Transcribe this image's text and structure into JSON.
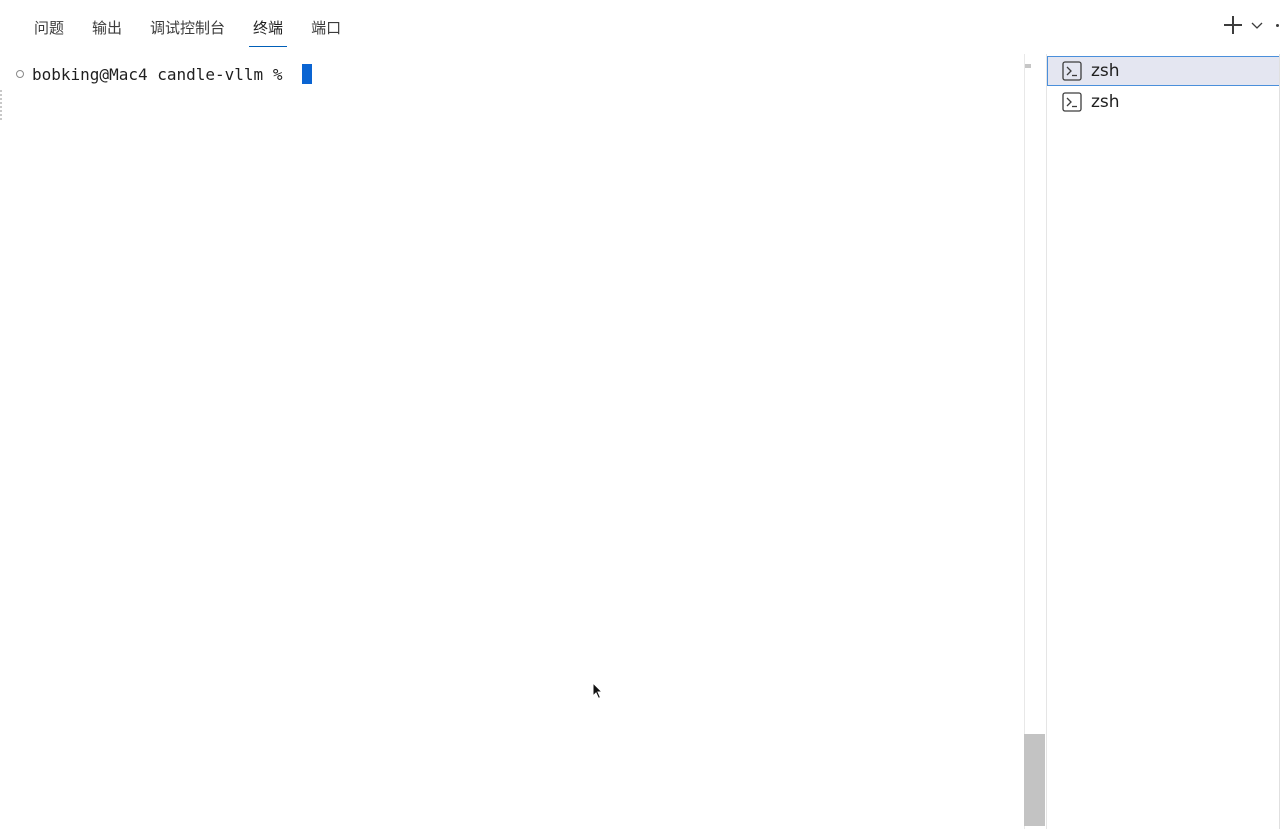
{
  "panel_tabs": [
    {
      "label": "问题"
    },
    {
      "label": "输出"
    },
    {
      "label": "调试控制台"
    },
    {
      "label": "终端"
    },
    {
      "label": "端口"
    }
  ],
  "active_tab": "终端",
  "toolbar": {
    "new_terminal_icon": "plus-icon",
    "dropdown_icon": "chevron-down-icon",
    "more_icon": "ellipsis-icon"
  },
  "terminal": {
    "prompt": "bobking@Mac4 candle-vllm % ",
    "cursor_color": "#0a64d2"
  },
  "terminal_list": [
    {
      "label": "zsh",
      "selected": true
    },
    {
      "label": "zsh",
      "selected": false
    }
  ],
  "colors": {
    "accent": "#005fb8",
    "selection_border": "#4a8fdb",
    "selection_bg": "#e4e6f1"
  }
}
